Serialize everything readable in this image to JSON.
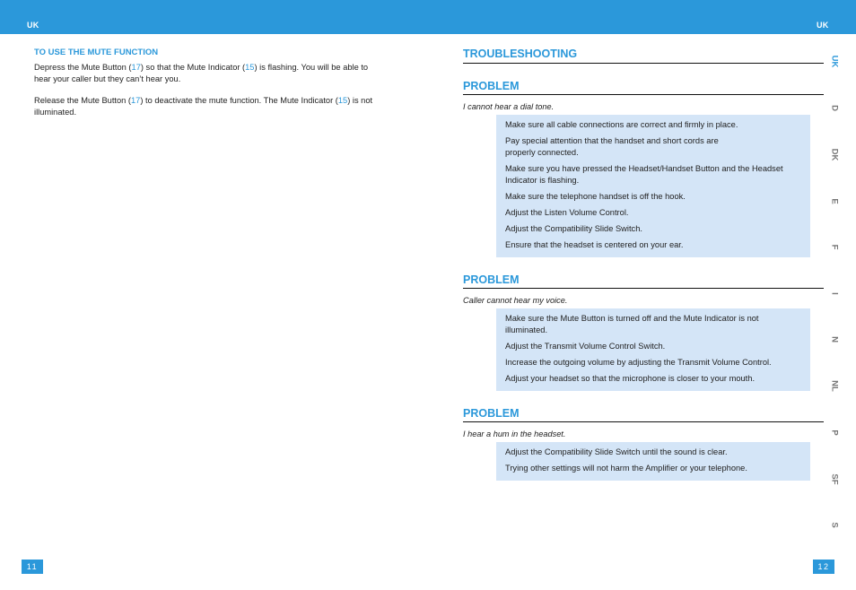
{
  "header": {
    "left_lang": "UK",
    "right_lang": "UK",
    "bar_color": "#2b98da"
  },
  "left_page": {
    "section_title": "TO USE THE MUTE FUNCTION",
    "paragraphs": [
      {
        "parts": [
          "Depress the Mute Button (",
          "17",
          ") so that the Mute Indicator (",
          "15",
          ") is flashing. You will be able to hear your caller but they can’t hear you."
        ]
      },
      {
        "parts": [
          "Release the Mute Button (",
          "17",
          ") to deactivate the mute function. The Mute Indicator (",
          "15",
          ") is not illuminated."
        ]
      }
    ],
    "page_number": "11"
  },
  "right_page": {
    "title": "TROUBLESHOOTING",
    "problems": [
      {
        "heading": "PROBLEM",
        "description": "I cannot hear a dial tone.",
        "solutions": [
          "Make sure all cable connections are correct and firmly in place.",
          "Pay special attention that the handset and short cords are properly connected.",
          "Make sure you have pressed the Headset/Handset Button and the Headset Indicator is flashing.",
          "Make sure the telephone handset is off the hook.",
          "Adjust the Listen Volume Control.",
          "Adjust the Compatibility Slide Switch.",
          "Ensure that the headset is centered on your ear."
        ]
      },
      {
        "heading": "PROBLEM",
        "description": "Caller cannot hear my voice.",
        "solutions": [
          "Make sure the Mute Button is turned off and the Mute Indicator is not illuminated.",
          "Adjust the Transmit Volume Control Switch.",
          "Increase the outgoing volume by adjusting the Transmit Volume Control.",
          "Adjust your headset so that the microphone is closer to your mouth."
        ]
      },
      {
        "heading": "PROBLEM",
        "description": "I hear a hum in the headset.",
        "solutions": [
          "Adjust the Compatibility Slide Switch until the sound is clear.",
          "Trying other settings will not harm the Amplifier or your telephone."
        ]
      }
    ],
    "page_number": "12"
  },
  "language_tabs": [
    {
      "label": "UK",
      "active": true
    },
    {
      "label": "D",
      "active": false
    },
    {
      "label": "DK",
      "active": false
    },
    {
      "label": "E",
      "active": false
    },
    {
      "label": "F",
      "active": false
    },
    {
      "label": "I",
      "active": false
    },
    {
      "label": "N",
      "active": false
    },
    {
      "label": "NL",
      "active": false
    },
    {
      "label": "P",
      "active": false
    },
    {
      "label": "SF",
      "active": false
    },
    {
      "label": "S",
      "active": false
    }
  ]
}
